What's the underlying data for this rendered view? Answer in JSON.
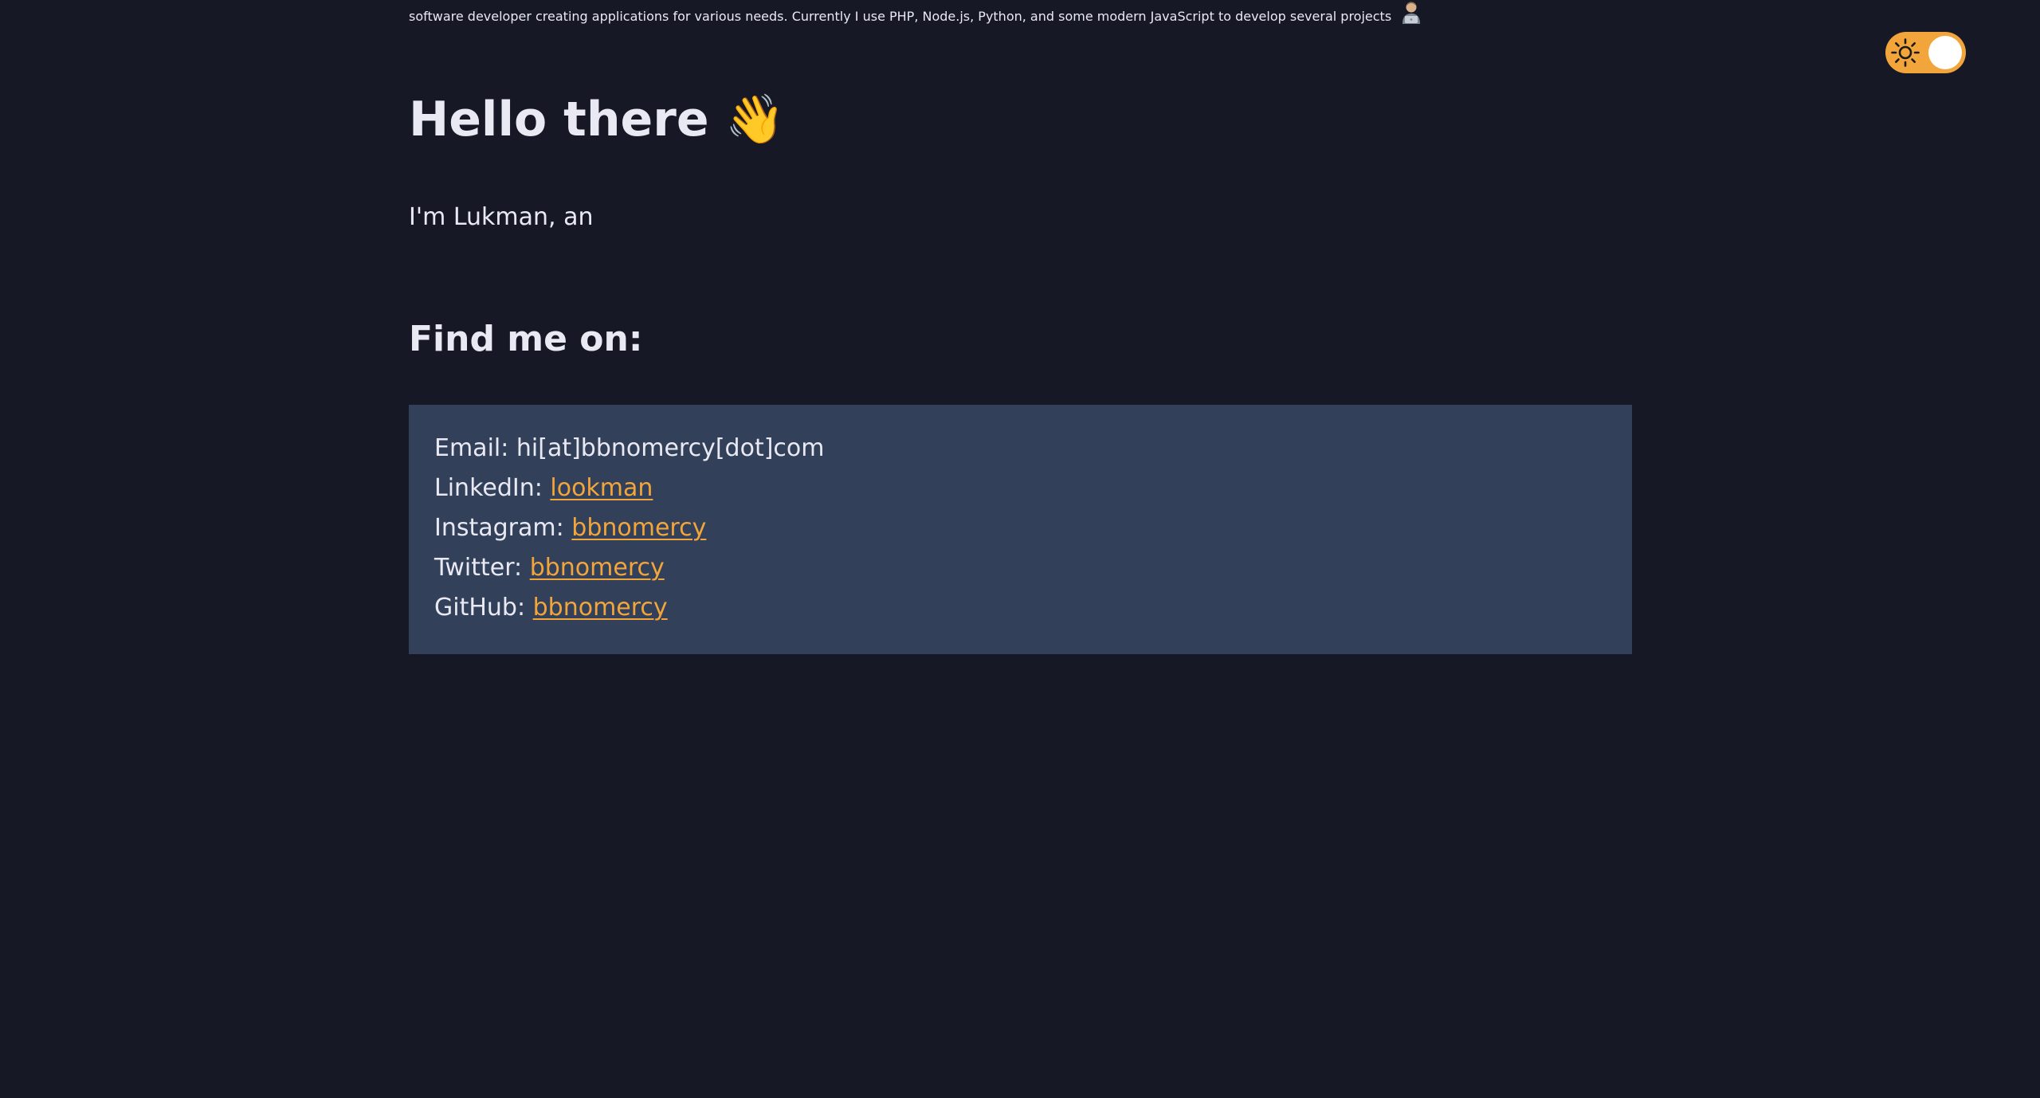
{
  "colors": {
    "background": "#171826",
    "text": "#e8e9f3",
    "box_background": "#33405a",
    "accent": "#f2a53a"
  },
  "theme_toggle": {
    "icon": "sun-icon",
    "state": "on"
  },
  "heading": {
    "text": "Hello there",
    "emoji": "👋"
  },
  "intro": {
    "part1": "I'm Lukman, an",
    "flag_icon": "indonesia-flag-icon",
    "part2": "software developer creating applications for various needs. Currently I use PHP, Node.js, Python, and some modern JavaScript to develop several projects",
    "trailing_icon": "technologist-icon"
  },
  "find_me": {
    "title": "Find me on:"
  },
  "contacts": {
    "email": {
      "label": "Email:",
      "value": "hi[at]bbnomercy[dot]com"
    },
    "linkedin": {
      "label": "LinkedIn:",
      "value": "lookman"
    },
    "instagram": {
      "label": "Instagram:",
      "value": "bbnomercy"
    },
    "twitter": {
      "label": "Twitter:",
      "value": "bbnomercy"
    },
    "github": {
      "label": "GitHub:",
      "value": "bbnomercy"
    }
  }
}
